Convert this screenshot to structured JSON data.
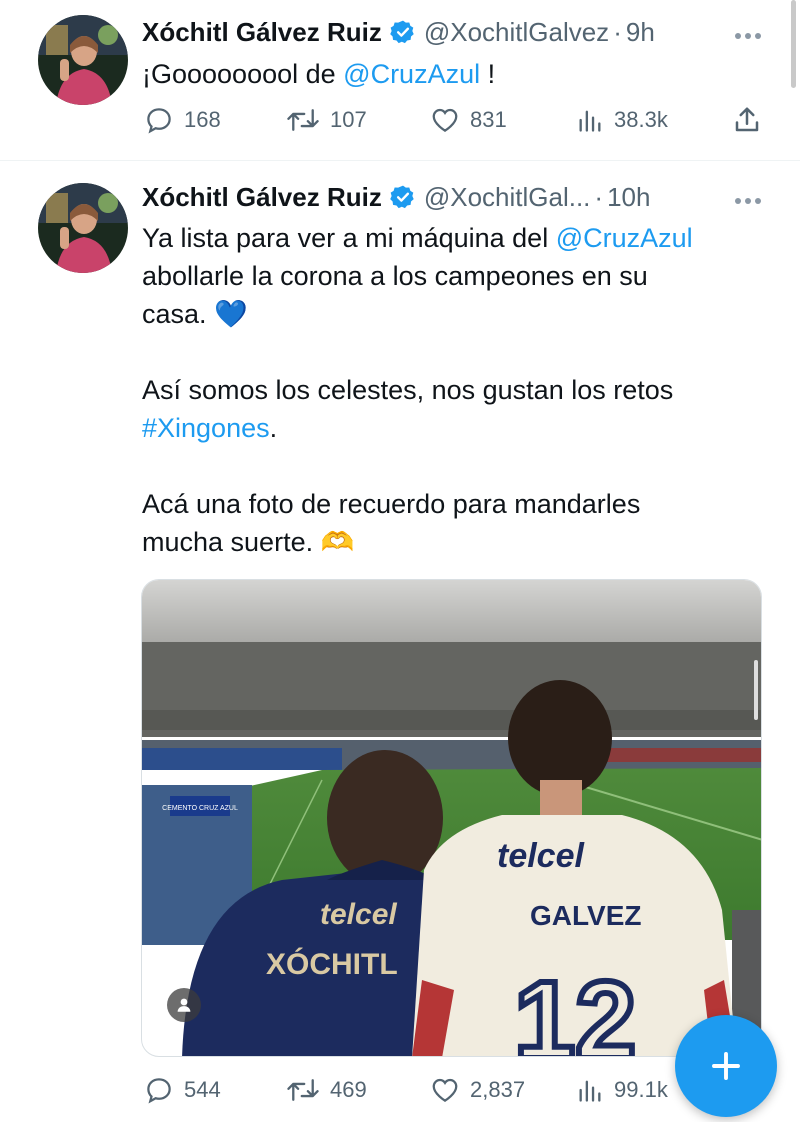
{
  "tweets": [
    {
      "name": "Xóchitl Gálvez Ruiz",
      "handle": "@XochitlGalvez",
      "separator": "·",
      "time": "9h",
      "text_parts": [
        "¡Gooooooool de ",
        "@CruzAzul",
        " !"
      ],
      "stats": {
        "replies": "168",
        "retweets": "107",
        "likes": "831",
        "views": "38.3k"
      }
    },
    {
      "name": "Xóchitl Gálvez Ruiz",
      "handle": "@XochitlGal...",
      "separator": "·",
      "time": "10h",
      "lines": {
        "l1a": "Ya lista para ver a mi máquina del ",
        "l1b": "@CruzAzul",
        "l2": "abollarle la corona a los campeones en su",
        "l3": "casa. 💙",
        "l4": "Así somos los celestes, nos gustan los retos",
        "l5a": "#Xingones",
        "l5b": ".",
        "l6": "Acá una foto de recuerdo para mandarles",
        "l7": "mucha suerte. 🫶"
      },
      "photo": {
        "jersey_left_brand": "telcel",
        "jersey_left_name": "XÓCHITL",
        "jersey_right_brand": "telcel",
        "jersey_right_name": "GALVEZ",
        "jersey_right_number": "12",
        "banner": "CEMENTO CRUZ AZUL"
      },
      "stats": {
        "replies": "544",
        "retweets": "469",
        "likes": "2,837",
        "views": "99.1k"
      }
    }
  ],
  "icons": {
    "more": "more-icon",
    "verified": "verified-badge-icon",
    "reply": "reply-icon",
    "retweet": "retweet-icon",
    "like": "heart-icon",
    "views": "views-icon",
    "share": "share-icon",
    "compose": "plus-icon"
  },
  "colors": {
    "accent": "#1d9bf0",
    "text": "#0f1419",
    "muted": "#536471"
  }
}
